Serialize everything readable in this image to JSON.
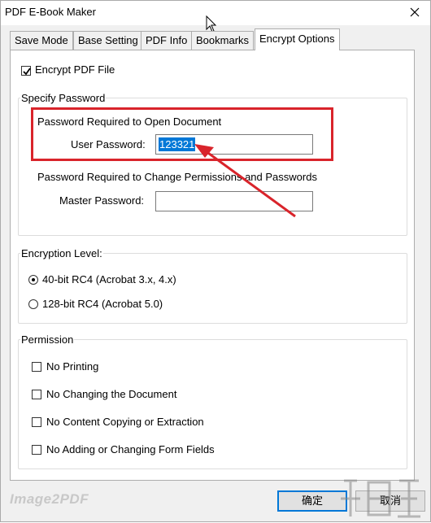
{
  "window": {
    "title": "PDF E-Book Maker"
  },
  "tabs": [
    {
      "label": "Save Mode",
      "active": false
    },
    {
      "label": "Base Setting",
      "active": false
    },
    {
      "label": "PDF Info",
      "active": false
    },
    {
      "label": "Bookmarks",
      "active": false
    },
    {
      "label": "Encrypt Options",
      "active": true
    }
  ],
  "encrypt": {
    "label": "Encrypt PDF File",
    "checked": true
  },
  "password": {
    "group_label": "Specify Password",
    "open_heading": "Password Required to Open Document",
    "user_label": "User Password:",
    "user_value": "123321",
    "perm_heading": "Password Required to Change Permissions and Passwords",
    "master_label": "Master Password:",
    "master_value": ""
  },
  "encryption": {
    "group_label": "Encryption Level:",
    "options": [
      {
        "label": "40-bit RC4 (Acrobat 3.x, 4.x)",
        "selected": true
      },
      {
        "label": "128-bit RC4 (Acrobat 5.0)",
        "selected": false
      }
    ]
  },
  "permission": {
    "group_label": "Permission",
    "items": [
      {
        "label": "No Printing",
        "checked": false
      },
      {
        "label": "No Changing the Document",
        "checked": false
      },
      {
        "label": "No Content Copying or Extraction",
        "checked": false
      },
      {
        "label": "No Adding or Changing Form Fields",
        "checked": false
      }
    ]
  },
  "footer": {
    "brand": "Image2PDF",
    "ok_label": "确定",
    "cancel_label": "取消"
  },
  "colors": {
    "accent": "#0078d7",
    "annotation": "#d9242b"
  }
}
